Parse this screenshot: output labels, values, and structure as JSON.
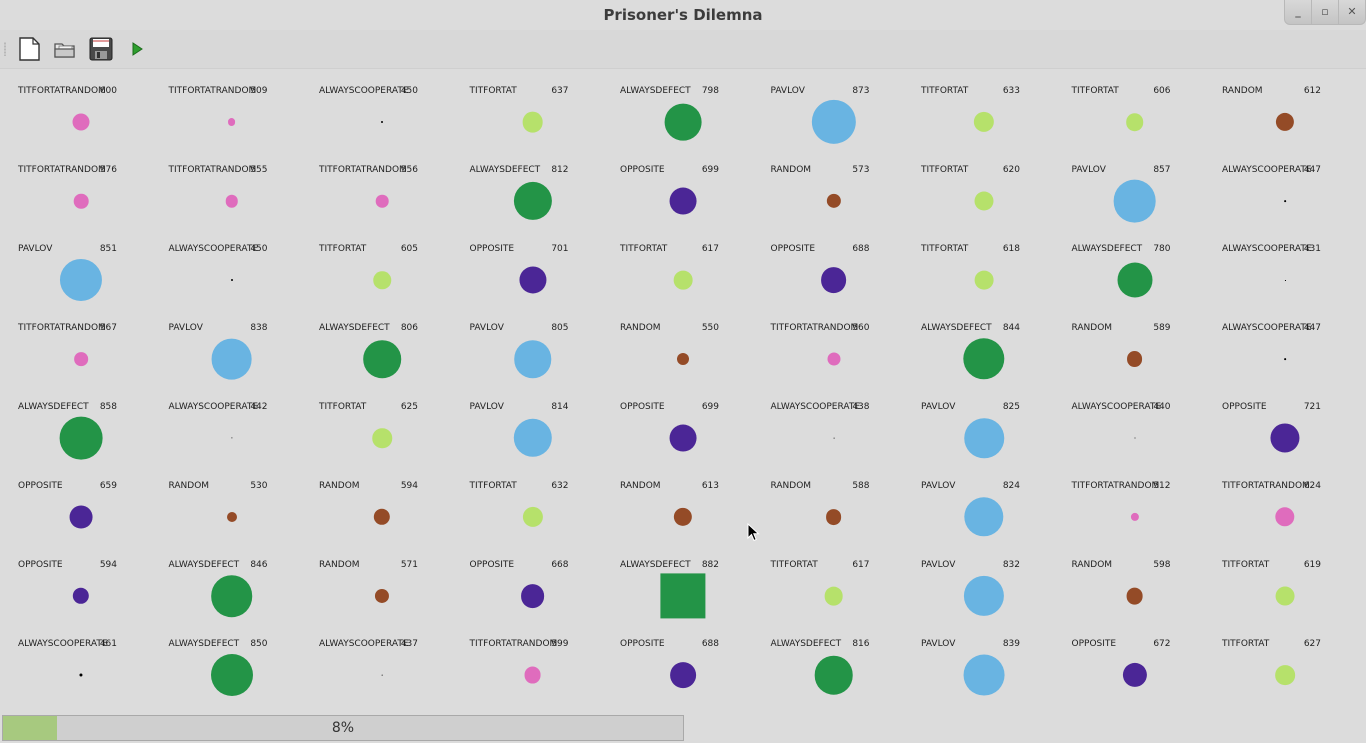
{
  "window": {
    "title": "Prisoner's Dilemna",
    "controls": [
      "_",
      "▫",
      "✕"
    ]
  },
  "toolbar": [
    {
      "name": "new-file-icon",
      "icon": "new-document"
    },
    {
      "name": "open-folder-icon",
      "icon": "folder"
    },
    {
      "name": "save-icon",
      "icon": "floppy-disk"
    },
    {
      "name": "run-icon",
      "icon": "play"
    }
  ],
  "strategy_colors": {
    "TITFORTATRANDOM": "#df6cbd",
    "ALWAYSCOOPERATE": "#000000",
    "TITFORTAT": "#b6e16b",
    "ALWAYSDEFECT": "#239447",
    "PAVLOV": "#69b4e2",
    "RANDOM": "#944b27",
    "OPPOSITE": "#4b2696"
  },
  "players": [
    [
      {
        "strategy": "TITFORTATRANDOM",
        "score": "600"
      },
      {
        "strategy": "TITFORTATRANDOM",
        "score": "509"
      },
      {
        "strategy": "ALWAYSCOOPERATE",
        "score": "450"
      },
      {
        "strategy": "TITFORTAT",
        "score": "637"
      },
      {
        "strategy": "ALWAYSDEFECT",
        "score": "798"
      },
      {
        "strategy": "PAVLOV",
        "score": "873"
      },
      {
        "strategy": "TITFORTAT",
        "score": "633"
      },
      {
        "strategy": "TITFORTAT",
        "score": "606"
      },
      {
        "strategy": "RANDOM",
        "score": "612"
      }
    ],
    [
      {
        "strategy": "TITFORTATRANDOM",
        "score": "576"
      },
      {
        "strategy": "TITFORTATRANDOM",
        "score": "555"
      },
      {
        "strategy": "TITFORTATRANDOM",
        "score": "556"
      },
      {
        "strategy": "ALWAYSDEFECT",
        "score": "812"
      },
      {
        "strategy": "OPPOSITE",
        "score": "699"
      },
      {
        "strategy": "RANDOM",
        "score": "573"
      },
      {
        "strategy": "TITFORTAT",
        "score": "620"
      },
      {
        "strategy": "PAVLOV",
        "score": "857"
      },
      {
        "strategy": "ALWAYSCOOPERATE",
        "score": "447"
      }
    ],
    [
      {
        "strategy": "PAVLOV",
        "score": "851"
      },
      {
        "strategy": "ALWAYSCOOPERATE",
        "score": "450"
      },
      {
        "strategy": "TITFORTAT",
        "score": "605"
      },
      {
        "strategy": "OPPOSITE",
        "score": "701"
      },
      {
        "strategy": "TITFORTAT",
        "score": "617"
      },
      {
        "strategy": "OPPOSITE",
        "score": "688"
      },
      {
        "strategy": "TITFORTAT",
        "score": "618"
      },
      {
        "strategy": "ALWAYSDEFECT",
        "score": "780"
      },
      {
        "strategy": "ALWAYSCOOPERATE",
        "score": "431"
      }
    ],
    [
      {
        "strategy": "TITFORTATRANDOM",
        "score": "567"
      },
      {
        "strategy": "PAVLOV",
        "score": "838"
      },
      {
        "strategy": "ALWAYSDEFECT",
        "score": "806"
      },
      {
        "strategy": "PAVLOV",
        "score": "805"
      },
      {
        "strategy": "RANDOM",
        "score": "550"
      },
      {
        "strategy": "TITFORTATRANDOM",
        "score": "560"
      },
      {
        "strategy": "ALWAYSDEFECT",
        "score": "844"
      },
      {
        "strategy": "RANDOM",
        "score": "589"
      },
      {
        "strategy": "ALWAYSCOOPERATE",
        "score": "447"
      }
    ],
    [
      {
        "strategy": "ALWAYSDEFECT",
        "score": "858"
      },
      {
        "strategy": "ALWAYSCOOPERATE",
        "score": "442"
      },
      {
        "strategy": "TITFORTAT",
        "score": "625"
      },
      {
        "strategy": "PAVLOV",
        "score": "814"
      },
      {
        "strategy": "OPPOSITE",
        "score": "699"
      },
      {
        "strategy": "ALWAYSCOOPERATE",
        "score": "438"
      },
      {
        "strategy": "PAVLOV",
        "score": "825"
      },
      {
        "strategy": "ALWAYSCOOPERATE",
        "score": "440"
      },
      {
        "strategy": "OPPOSITE",
        "score": "721"
      }
    ],
    [
      {
        "strategy": "OPPOSITE",
        "score": "659"
      },
      {
        "strategy": "RANDOM",
        "score": "530"
      },
      {
        "strategy": "RANDOM",
        "score": "594"
      },
      {
        "strategy": "TITFORTAT",
        "score": "632"
      },
      {
        "strategy": "RANDOM",
        "score": "613"
      },
      {
        "strategy": "RANDOM",
        "score": "588"
      },
      {
        "strategy": "PAVLOV",
        "score": "824"
      },
      {
        "strategy": "TITFORTATRANDOM",
        "score": "512"
      },
      {
        "strategy": "TITFORTATRANDOM",
        "score": "624"
      }
    ],
    [
      {
        "strategy": "OPPOSITE",
        "score": "594"
      },
      {
        "strategy": "ALWAYSDEFECT",
        "score": "846"
      },
      {
        "strategy": "RANDOM",
        "score": "571"
      },
      {
        "strategy": "OPPOSITE",
        "score": "668"
      },
      {
        "strategy": "ALWAYSDEFECT",
        "score": "882",
        "shape": "square"
      },
      {
        "strategy": "TITFORTAT",
        "score": "617"
      },
      {
        "strategy": "PAVLOV",
        "score": "832"
      },
      {
        "strategy": "RANDOM",
        "score": "598"
      },
      {
        "strategy": "TITFORTAT",
        "score": "619"
      }
    ],
    [
      {
        "strategy": "ALWAYSCOOPERATE",
        "score": "461"
      },
      {
        "strategy": "ALWAYSDEFECT",
        "score": "850"
      },
      {
        "strategy": "ALWAYSCOOPERATE",
        "score": "437"
      },
      {
        "strategy": "TITFORTATRANDOM",
        "score": "599"
      },
      {
        "strategy": "OPPOSITE",
        "score": "688"
      },
      {
        "strategy": "ALWAYSDEFECT",
        "score": "816"
      },
      {
        "strategy": "PAVLOV",
        "score": "839"
      },
      {
        "strategy": "OPPOSITE",
        "score": "672"
      },
      {
        "strategy": "TITFORTAT",
        "score": "627"
      }
    ]
  ],
  "progress": {
    "value": 0.08,
    "label": "8%"
  }
}
